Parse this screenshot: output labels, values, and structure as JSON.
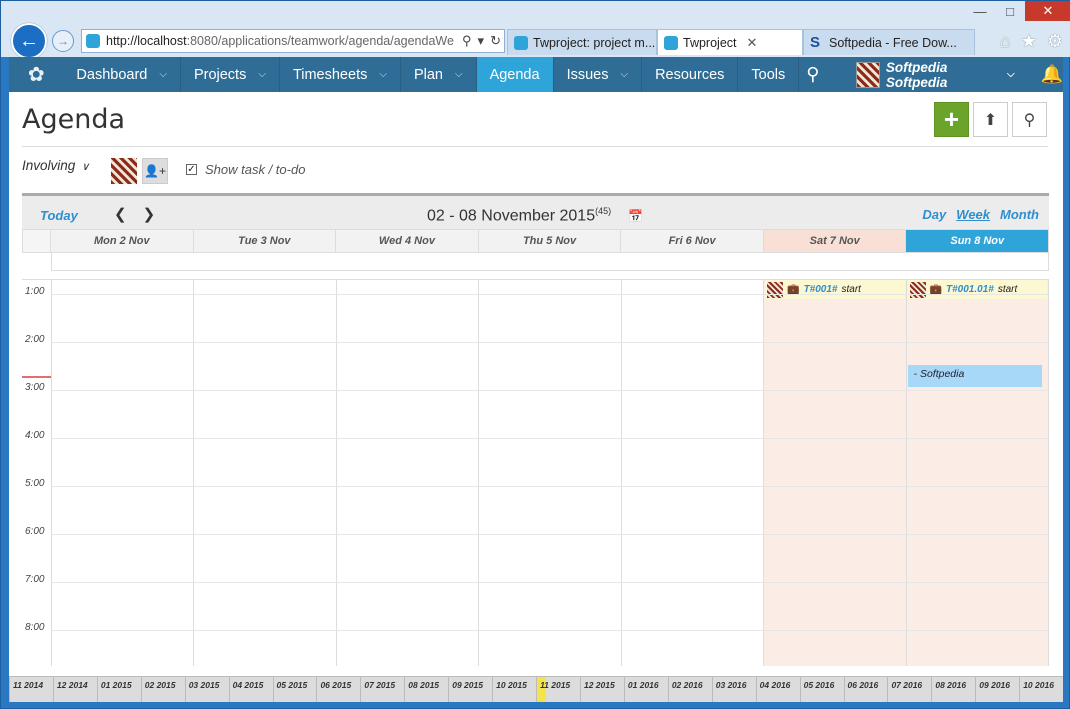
{
  "browser": {
    "address_host": "http://localhost",
    "address_path": ":8080/applications/teamwork/agenda/agendaWe",
    "tabs": [
      {
        "label": "Twproject: project m...",
        "active": false,
        "icon": "twproject-icon"
      },
      {
        "label": "Twproject",
        "active": true,
        "icon": "twproject-icon"
      },
      {
        "label": "Softpedia - Free Dow...",
        "active": false,
        "icon": "softpedia-icon"
      }
    ]
  },
  "nav": {
    "items": [
      {
        "label": "Dashboard",
        "chevron": true,
        "active": false
      },
      {
        "label": "Projects",
        "chevron": true,
        "active": false
      },
      {
        "label": "Timesheets",
        "chevron": true,
        "active": false
      },
      {
        "label": "Plan",
        "chevron": true,
        "active": false
      },
      {
        "label": "Agenda",
        "chevron": false,
        "active": true
      },
      {
        "label": "Issues",
        "chevron": true,
        "active": false
      },
      {
        "label": "Resources",
        "chevron": false,
        "active": false
      },
      {
        "label": "Tools",
        "chevron": false,
        "active": false
      }
    ],
    "user_name": "Softpedia Softpedia"
  },
  "page": {
    "title": "Agenda",
    "involving_label": "Involving",
    "show_task_label": "Show task / to-do",
    "show_task_checked": true
  },
  "calendar": {
    "today_label": "Today",
    "range_label": "02 - 08 November 2015",
    "week_number": "(45)",
    "views": [
      "Day",
      "Week",
      "Month"
    ],
    "selected_view": "Week",
    "days": [
      "Mon 2 Nov",
      "Tue 3 Nov",
      "Wed 4 Nov",
      "Thu 5 Nov",
      "Fri 6 Nov",
      "Sat 7 Nov",
      "Sun 8 Nov"
    ],
    "hours": [
      "1:00",
      "2:00",
      "3:00",
      "4:00",
      "5:00",
      "6:00",
      "7:00",
      "8:00"
    ],
    "events": [
      {
        "day": "Sat 7 Nov",
        "code": "T#001#",
        "text": "start"
      },
      {
        "day": "Sun 8 Nov",
        "code": "T#001.01#",
        "text": "start"
      }
    ],
    "appointment": {
      "day": "Sun 8 Nov",
      "text": "- Softpedia"
    }
  },
  "timeline": [
    "11 2014",
    "12 2014",
    "01 2015",
    "02 2015",
    "03 2015",
    "04 2015",
    "05 2015",
    "06 2015",
    "07 2015",
    "08 2015",
    "09 2015",
    "10 2015",
    "11 2015",
    "12 2015",
    "01 2016",
    "02 2016",
    "03 2016",
    "04 2016",
    "05 2016",
    "06 2016",
    "07 2016",
    "08 2016",
    "09 2016",
    "10 2016"
  ],
  "timeline_current": "11 2015",
  "colors": {
    "nav_bg": "#2f6d97",
    "accent": "#2fa4d9",
    "add_button": "#6aa42a",
    "weekend": "#fbece6"
  }
}
